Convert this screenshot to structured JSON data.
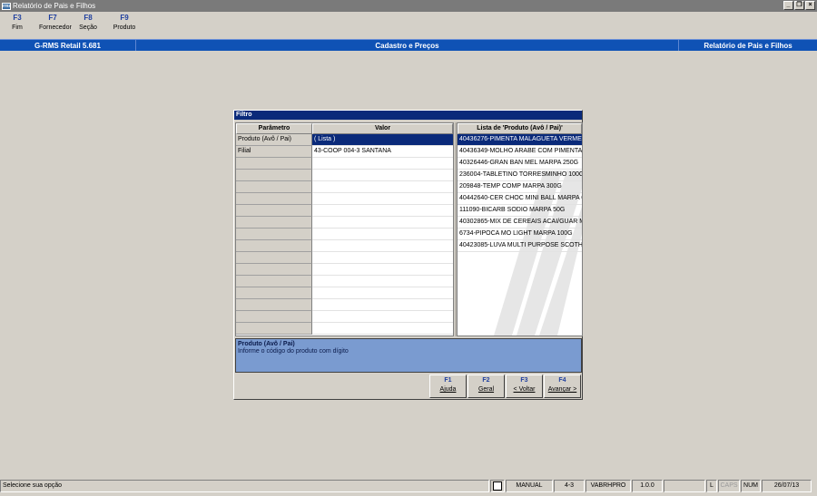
{
  "window": {
    "title": "Relatório de Pais e Filhos",
    "app_icon": "app-icon"
  },
  "fkeys": [
    {
      "key": "F3",
      "label": "Fim"
    },
    {
      "key": "F7",
      "label": "Fornecedor"
    },
    {
      "key": "F8",
      "label": "Seção"
    },
    {
      "key": "F9",
      "label": "Produto"
    }
  ],
  "banner": {
    "version": "G-RMS Retail 5.681",
    "module": "Cadastro e Preços",
    "report": "Relatório de Pais e Filhos"
  },
  "dialog": {
    "title": "Filtro",
    "grid": {
      "col_param": "Parâmetro",
      "col_value": "Valor",
      "rows": [
        {
          "param": "Produto (Avô / Pai)",
          "value": "( Lista )"
        },
        {
          "param": "Filial",
          "value": "43-COOP 004-3  SANTANA"
        },
        {
          "param": "",
          "value": ""
        },
        {
          "param": "",
          "value": ""
        },
        {
          "param": "",
          "value": ""
        },
        {
          "param": "",
          "value": ""
        },
        {
          "param": "",
          "value": ""
        },
        {
          "param": "",
          "value": ""
        },
        {
          "param": "",
          "value": ""
        },
        {
          "param": "",
          "value": ""
        },
        {
          "param": "",
          "value": ""
        },
        {
          "param": "",
          "value": ""
        },
        {
          "param": "",
          "value": ""
        },
        {
          "param": "",
          "value": ""
        },
        {
          "param": "",
          "value": ""
        },
        {
          "param": "",
          "value": ""
        },
        {
          "param": "",
          "value": ""
        }
      ]
    },
    "list": {
      "header": "Lista de 'Produto (Avô / Pai)'",
      "items": [
        "40436276-PIMENTA MALAGUETA VERMELHA",
        "40436349-MOLHO ARABE COM PIMENTA MA",
        "40326446-GRAN BAN MEL MARPA 250G",
        "236004-TABLETINO TORRESMINHO 100G",
        "209848-TEMP COMP MARPA 300G",
        "40442640-CER CHOC MINI BALL MARPA 60G",
        "111090-BICARB SODIO MARPA 50G",
        "40302865-MIX DE CEREAIS ACAI/GUAR MAR",
        "6734-PIPOCA MO LIGHT MARPA 100G",
        "40423085-LUVA MULTI PURPOSE SCOTH BR"
      ]
    },
    "help": {
      "title": "Produto (Avô / Pai)",
      "text": "Informe o código do produto com dígito"
    },
    "buttons": [
      {
        "key": "F1",
        "label": "Ajuda"
      },
      {
        "key": "F2",
        "label": "Geral"
      },
      {
        "key": "F3",
        "label": "< Voltar"
      },
      {
        "key": "F4",
        "label": "Avançar >"
      }
    ]
  },
  "statusbar": {
    "message": "Selecione sua opção",
    "mode": "MANUAL",
    "code": "4-3",
    "user": "VABRHPRO",
    "version": "1.0.0",
    "empty": "",
    "l": "L",
    "caps": "CAPS",
    "num": "NUM",
    "date": "26/07/13"
  },
  "colors": {
    "banner": "#0f52b5",
    "selection": "#0a2a7a",
    "help_bg": "#7a9bd0"
  }
}
